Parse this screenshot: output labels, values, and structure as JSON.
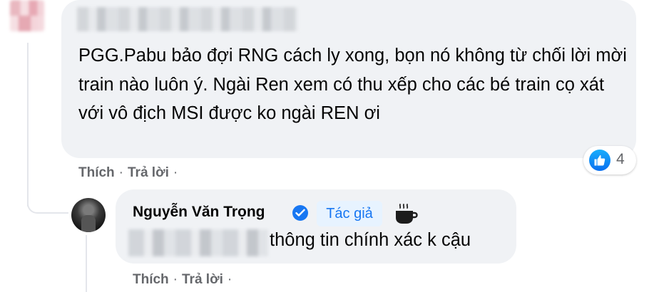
{
  "comment1": {
    "text": "PGG.Pabu bảo đợi RNG cách ly xong, bọn nó không từ chối lời mời train nào luôn ý. Ngài Ren xem có thu xếp cho các bé train cọ xát với vô địch MSI được ko ngài REN ơi",
    "reaction_icon": "like-icon",
    "reaction_count": "4",
    "actions": {
      "like": "Thích",
      "separator": "·",
      "reply": "Trả lời",
      "trailing": "·"
    }
  },
  "reply1": {
    "author": "Nguyễn Văn Trọng",
    "author_badge": "Tác giả",
    "badge_icon": "coffee-icon",
    "verified_icon": "verified-icon",
    "text": "thông tin chính xác k cậu",
    "actions": {
      "like": "Thích",
      "separator": "·",
      "reply": "Trả lời",
      "trailing": "·"
    }
  },
  "colors": {
    "bubble_bg": "#f0f2f5",
    "link_blue": "#1877f2",
    "secondary_text": "#65676b",
    "badge_bg": "#e7f3ff"
  }
}
